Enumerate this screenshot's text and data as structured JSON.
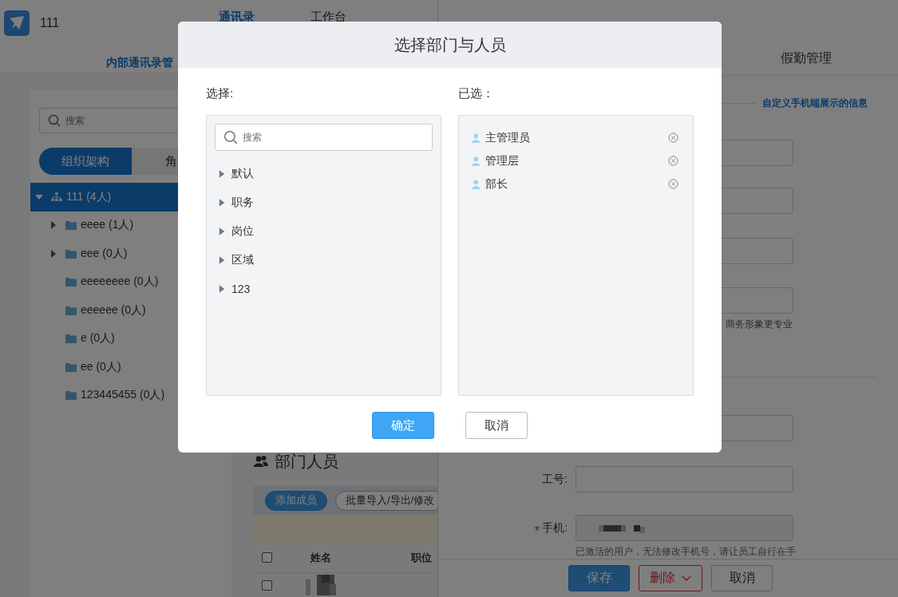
{
  "header": {
    "app_name": "111",
    "nav": [
      {
        "label": "通讯录",
        "selected": true
      },
      {
        "label": "工作台",
        "selected": false
      }
    ],
    "subnav": {
      "label": "内部通讯录管",
      "selected": true
    }
  },
  "sidebar": {
    "search": {
      "placeholder": "搜索"
    },
    "tabs": [
      {
        "label": "组织架构",
        "selected": true
      },
      {
        "label": "角",
        "selected": false
      }
    ],
    "tree": [
      {
        "label": "111 (4人)",
        "kind": "org",
        "expanded": true,
        "selected": true,
        "children": [
          {
            "label": "eeee (1人)",
            "kind": "branch",
            "expanded": false,
            "selected": false
          },
          {
            "label": "eee (0人)",
            "kind": "branch",
            "expanded": false,
            "selected": false
          },
          {
            "label": "eeeeeeee (0人)",
            "kind": "leaf",
            "selected": false
          },
          {
            "label": "eeeeee (0人)",
            "kind": "leaf",
            "selected": false
          },
          {
            "label": "e (0人)",
            "kind": "leaf",
            "selected": false
          },
          {
            "label": "ee (0人)",
            "kind": "leaf",
            "selected": false
          },
          {
            "label": "123445455 (0人)",
            "kind": "leaf",
            "selected": false
          }
        ]
      }
    ]
  },
  "department": {
    "title": "部门人员",
    "buttons": [
      {
        "label": "添加成员",
        "kind": "primary"
      },
      {
        "label": "批量导入/导出/修改",
        "kind": "default"
      }
    ],
    "columns": [
      "姓名",
      "职位"
    ],
    "header_checked": false,
    "rows": [
      {
        "checked": false,
        "kind": "picture"
      }
    ]
  },
  "drawer": {
    "tab": "假勤管理",
    "link": "自定义手机端展示的信息",
    "photo_hint": "商务形象更专业",
    "fields": [
      {
        "label": "工号:",
        "required": false,
        "disabled": false
      },
      {
        "label": "手机:",
        "required": true,
        "disabled": true
      }
    ],
    "phone_hint": "已激活的用户，无法修改手机号，请让员工自行在手",
    "buttons": [
      {
        "label": "保存",
        "kind": "primary"
      },
      {
        "label": "删除",
        "kind": "danger"
      },
      {
        "label": "取消",
        "kind": "default"
      }
    ]
  },
  "dialog": {
    "title": "选择部门与人员",
    "choose_label": "选择:",
    "search": {
      "placeholder": "搜索"
    },
    "tree": [
      {
        "label": "默认",
        "expanded": false
      },
      {
        "label": "职务",
        "expanded": false
      },
      {
        "label": "岗位",
        "expanded": false
      },
      {
        "label": "区域",
        "expanded": false
      },
      {
        "label": "123",
        "expanded": false
      }
    ],
    "selected_label": "已选：",
    "selected": [
      {
        "label": "主管理员"
      },
      {
        "label": "管理层"
      },
      {
        "label": "部长"
      }
    ],
    "buttons": [
      {
        "label": "确定",
        "kind": "primary"
      },
      {
        "label": "取消",
        "kind": "default"
      }
    ]
  }
}
